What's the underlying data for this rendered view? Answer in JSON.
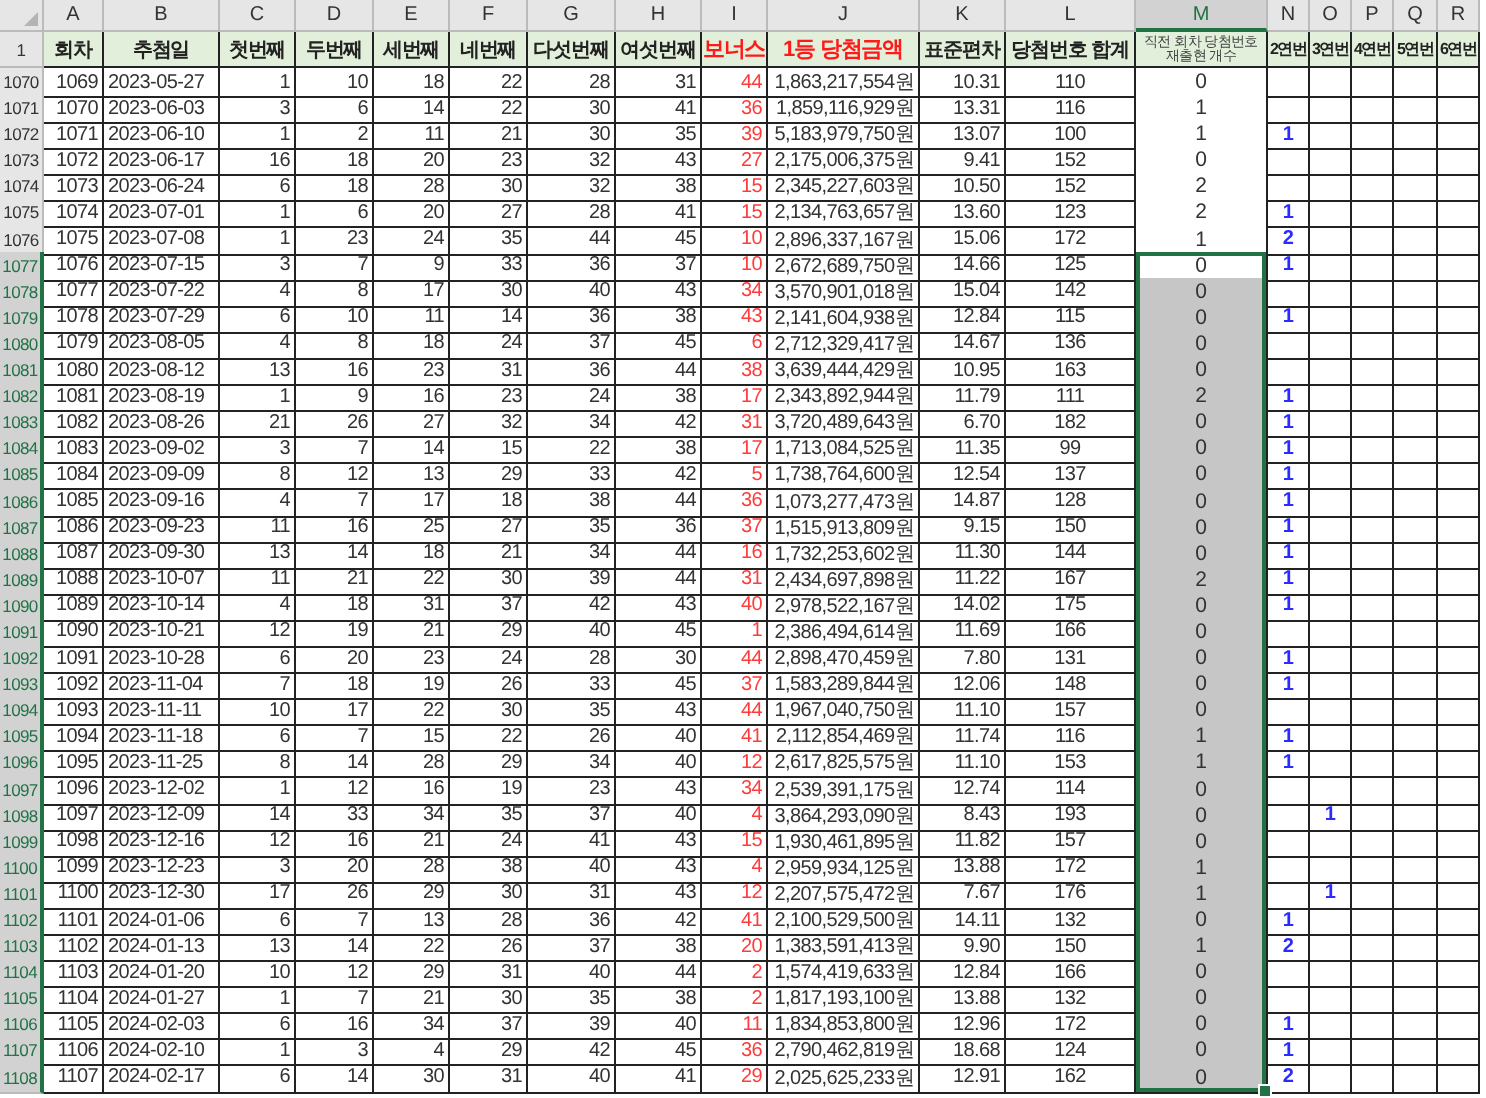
{
  "columns": [
    {
      "letter": "A",
      "selected": false
    },
    {
      "letter": "B",
      "selected": false
    },
    {
      "letter": "C",
      "selected": false
    },
    {
      "letter": "D",
      "selected": false
    },
    {
      "letter": "E",
      "selected": false
    },
    {
      "letter": "F",
      "selected": false
    },
    {
      "letter": "G",
      "selected": false
    },
    {
      "letter": "H",
      "selected": false
    },
    {
      "letter": "I",
      "selected": false
    },
    {
      "letter": "J",
      "selected": false
    },
    {
      "letter": "K",
      "selected": false
    },
    {
      "letter": "L",
      "selected": false
    },
    {
      "letter": "M",
      "selected": true
    },
    {
      "letter": "N",
      "selected": false
    },
    {
      "letter": "O",
      "selected": false
    },
    {
      "letter": "P",
      "selected": false
    },
    {
      "letter": "Q",
      "selected": false
    },
    {
      "letter": "R",
      "selected": false
    }
  ],
  "header_row": "1",
  "headers": [
    {
      "text": "회차",
      "kind": "plain"
    },
    {
      "text": "추첨일",
      "kind": "plain"
    },
    {
      "text": "첫번째",
      "kind": "plain"
    },
    {
      "text": "두번째",
      "kind": "plain"
    },
    {
      "text": "세번째",
      "kind": "plain"
    },
    {
      "text": "네번째",
      "kind": "plain"
    },
    {
      "text": "다섯번째",
      "kind": "plain"
    },
    {
      "text": "여섯번째",
      "kind": "plain"
    },
    {
      "text": "보너스",
      "kind": "red"
    },
    {
      "text": "1등 당첨금액",
      "kind": "red"
    },
    {
      "text": "표준편차",
      "kind": "plain"
    },
    {
      "text": "당첨번호 합계",
      "kind": "plain"
    },
    {
      "text": "직전 회차 당첨번호 재출현 개수",
      "kind": "tiny"
    },
    {
      "text": "2연번",
      "kind": "small"
    },
    {
      "text": "3연번",
      "kind": "small"
    },
    {
      "text": "4연번",
      "kind": "small"
    },
    {
      "text": "5연번",
      "kind": "small"
    },
    {
      "text": "6연번",
      "kind": "small"
    }
  ],
  "rows": [
    {
      "row": "1070",
      "round": "1069",
      "date": "2023-05-27",
      "numbers": [
        "1",
        "10",
        "18",
        "22",
        "28",
        "31"
      ],
      "bonus": "44",
      "prize": "1,863,217,554원",
      "stdev": "10.31",
      "sum": "110",
      "repeat": "0",
      "selected": false,
      "active": false
    },
    {
      "row": "1071",
      "round": "1070",
      "date": "2023-06-03",
      "numbers": [
        "3",
        "6",
        "14",
        "22",
        "30",
        "41"
      ],
      "bonus": "36",
      "prize": "1,859,116,929원",
      "stdev": "13.31",
      "sum": "116",
      "repeat": "1",
      "selected": false,
      "active": false
    },
    {
      "row": "1072",
      "round": "1071",
      "date": "2023-06-10",
      "numbers": [
        "1",
        "2",
        "11",
        "21",
        "30",
        "35"
      ],
      "bonus": "39",
      "prize": "5,183,979,750원",
      "stdev": "13.07",
      "sum": "100",
      "repeat": "1",
      "run2": "1",
      "selected": false,
      "active": false
    },
    {
      "row": "1073",
      "round": "1072",
      "date": "2023-06-17",
      "numbers": [
        "16",
        "18",
        "20",
        "23",
        "32",
        "43"
      ],
      "bonus": "27",
      "prize": "2,175,006,375원",
      "stdev": "9.41",
      "sum": "152",
      "repeat": "0",
      "selected": false,
      "active": false
    },
    {
      "row": "1074",
      "round": "1073",
      "date": "2023-06-24",
      "numbers": [
        "6",
        "18",
        "28",
        "30",
        "32",
        "38"
      ],
      "bonus": "15",
      "prize": "2,345,227,603원",
      "stdev": "10.50",
      "sum": "152",
      "repeat": "2",
      "selected": false,
      "active": false
    },
    {
      "row": "1075",
      "round": "1074",
      "date": "2023-07-01",
      "numbers": [
        "1",
        "6",
        "20",
        "27",
        "28",
        "41"
      ],
      "bonus": "15",
      "prize": "2,134,763,657원",
      "stdev": "13.60",
      "sum": "123",
      "repeat": "2",
      "run2": "1",
      "selected": false,
      "active": false
    },
    {
      "row": "1076",
      "round": "1075",
      "date": "2023-07-08",
      "numbers": [
        "1",
        "23",
        "24",
        "35",
        "44",
        "45"
      ],
      "bonus": "10",
      "prize": "2,896,337,167원",
      "stdev": "15.06",
      "sum": "172",
      "repeat": "1",
      "run2": "2",
      "selected": false,
      "active": false
    },
    {
      "row": "1077",
      "round": "1076",
      "date": "2023-07-15",
      "numbers": [
        "3",
        "7",
        "9",
        "33",
        "36",
        "37"
      ],
      "bonus": "10",
      "prize": "2,672,689,750원",
      "stdev": "14.66",
      "sum": "125",
      "repeat": "0",
      "run2": "1",
      "selected": true,
      "active": true
    },
    {
      "row": "1078",
      "round": "1077",
      "date": "2023-07-22",
      "numbers": [
        "4",
        "8",
        "17",
        "30",
        "40",
        "43"
      ],
      "bonus": "34",
      "prize": "3,570,901,018원",
      "stdev": "15.04",
      "sum": "142",
      "repeat": "0",
      "selected": true,
      "active": false
    },
    {
      "row": "1079",
      "round": "1078",
      "date": "2023-07-29",
      "numbers": [
        "6",
        "10",
        "11",
        "14",
        "36",
        "38"
      ],
      "bonus": "43",
      "prize": "2,141,604,938원",
      "stdev": "12.84",
      "sum": "115",
      "repeat": "0",
      "run2": "1",
      "selected": true,
      "active": false
    },
    {
      "row": "1080",
      "round": "1079",
      "date": "2023-08-05",
      "numbers": [
        "4",
        "8",
        "18",
        "24",
        "37",
        "45"
      ],
      "bonus": "6",
      "prize": "2,712,329,417원",
      "stdev": "14.67",
      "sum": "136",
      "repeat": "0",
      "selected": true,
      "active": false
    },
    {
      "row": "1081",
      "round": "1080",
      "date": "2023-08-12",
      "numbers": [
        "13",
        "16",
        "23",
        "31",
        "36",
        "44"
      ],
      "bonus": "38",
      "prize": "3,639,444,429원",
      "stdev": "10.95",
      "sum": "163",
      "repeat": "0",
      "selected": true,
      "active": false
    },
    {
      "row": "1082",
      "round": "1081",
      "date": "2023-08-19",
      "numbers": [
        "1",
        "9",
        "16",
        "23",
        "24",
        "38"
      ],
      "bonus": "17",
      "prize": "2,343,892,944원",
      "stdev": "11.79",
      "sum": "111",
      "repeat": "2",
      "run2": "1",
      "selected": true,
      "active": false
    },
    {
      "row": "1083",
      "round": "1082",
      "date": "2023-08-26",
      "numbers": [
        "21",
        "26",
        "27",
        "32",
        "34",
        "42"
      ],
      "bonus": "31",
      "prize": "3,720,489,643원",
      "stdev": "6.70",
      "sum": "182",
      "repeat": "0",
      "run2": "1",
      "selected": true,
      "active": false
    },
    {
      "row": "1084",
      "round": "1083",
      "date": "2023-09-02",
      "numbers": [
        "3",
        "7",
        "14",
        "15",
        "22",
        "38"
      ],
      "bonus": "17",
      "prize": "1,713,084,525원",
      "stdev": "11.35",
      "sum": "99",
      "repeat": "0",
      "run2": "1",
      "selected": true,
      "active": false
    },
    {
      "row": "1085",
      "round": "1084",
      "date": "2023-09-09",
      "numbers": [
        "8",
        "12",
        "13",
        "29",
        "33",
        "42"
      ],
      "bonus": "5",
      "prize": "1,738,764,600원",
      "stdev": "12.54",
      "sum": "137",
      "repeat": "0",
      "run2": "1",
      "selected": true,
      "active": false
    },
    {
      "row": "1086",
      "round": "1085",
      "date": "2023-09-16",
      "numbers": [
        "4",
        "7",
        "17",
        "18",
        "38",
        "44"
      ],
      "bonus": "36",
      "prize": "1,073,277,473원",
      "stdev": "14.87",
      "sum": "128",
      "repeat": "0",
      "run2": "1",
      "selected": true,
      "active": false
    },
    {
      "row": "1087",
      "round": "1086",
      "date": "2023-09-23",
      "numbers": [
        "11",
        "16",
        "25",
        "27",
        "35",
        "36"
      ],
      "bonus": "37",
      "prize": "1,515,913,809원",
      "stdev": "9.15",
      "sum": "150",
      "repeat": "0",
      "run2": "1",
      "selected": true,
      "active": false
    },
    {
      "row": "1088",
      "round": "1087",
      "date": "2023-09-30",
      "numbers": [
        "13",
        "14",
        "18",
        "21",
        "34",
        "44"
      ],
      "bonus": "16",
      "prize": "1,732,253,602원",
      "stdev": "11.30",
      "sum": "144",
      "repeat": "0",
      "run2": "1",
      "selected": true,
      "active": false
    },
    {
      "row": "1089",
      "round": "1088",
      "date": "2023-10-07",
      "numbers": [
        "11",
        "21",
        "22",
        "30",
        "39",
        "44"
      ],
      "bonus": "31",
      "prize": "2,434,697,898원",
      "stdev": "11.22",
      "sum": "167",
      "repeat": "2",
      "run2": "1",
      "selected": true,
      "active": false
    },
    {
      "row": "1090",
      "round": "1089",
      "date": "2023-10-14",
      "numbers": [
        "4",
        "18",
        "31",
        "37",
        "42",
        "43"
      ],
      "bonus": "40",
      "prize": "2,978,522,167원",
      "stdev": "14.02",
      "sum": "175",
      "repeat": "0",
      "run2": "1",
      "selected": true,
      "active": false
    },
    {
      "row": "1091",
      "round": "1090",
      "date": "2023-10-21",
      "numbers": [
        "12",
        "19",
        "21",
        "29",
        "40",
        "45"
      ],
      "bonus": "1",
      "prize": "2,386,494,614원",
      "stdev": "11.69",
      "sum": "166",
      "repeat": "0",
      "selected": true,
      "active": false
    },
    {
      "row": "1092",
      "round": "1091",
      "date": "2023-10-28",
      "numbers": [
        "6",
        "20",
        "23",
        "24",
        "28",
        "30"
      ],
      "bonus": "44",
      "prize": "2,898,470,459원",
      "stdev": "7.80",
      "sum": "131",
      "repeat": "0",
      "run2": "1",
      "selected": true,
      "active": false
    },
    {
      "row": "1093",
      "round": "1092",
      "date": "2023-11-04",
      "numbers": [
        "7",
        "18",
        "19",
        "26",
        "33",
        "45"
      ],
      "bonus": "37",
      "prize": "1,583,289,844원",
      "stdev": "12.06",
      "sum": "148",
      "repeat": "0",
      "run2": "1",
      "selected": true,
      "active": false
    },
    {
      "row": "1094",
      "round": "1093",
      "date": "2023-11-11",
      "numbers": [
        "10",
        "17",
        "22",
        "30",
        "35",
        "43"
      ],
      "bonus": "44",
      "prize": "1,967,040,750원",
      "stdev": "11.10",
      "sum": "157",
      "repeat": "0",
      "selected": true,
      "active": false
    },
    {
      "row": "1095",
      "round": "1094",
      "date": "2023-11-18",
      "numbers": [
        "6",
        "7",
        "15",
        "22",
        "26",
        "40"
      ],
      "bonus": "41",
      "prize": "2,112,854,469원",
      "stdev": "11.74",
      "sum": "116",
      "repeat": "1",
      "run2": "1",
      "selected": true,
      "active": false
    },
    {
      "row": "1096",
      "round": "1095",
      "date": "2023-11-25",
      "numbers": [
        "8",
        "14",
        "28",
        "29",
        "34",
        "40"
      ],
      "bonus": "12",
      "prize": "2,617,825,575원",
      "stdev": "11.10",
      "sum": "153",
      "repeat": "1",
      "run2": "1",
      "selected": true,
      "active": false
    },
    {
      "row": "1097",
      "round": "1096",
      "date": "2023-12-02",
      "numbers": [
        "1",
        "12",
        "16",
        "19",
        "23",
        "43"
      ],
      "bonus": "34",
      "prize": "2,539,391,175원",
      "stdev": "12.74",
      "sum": "114",
      "repeat": "0",
      "selected": true,
      "active": false
    },
    {
      "row": "1098",
      "round": "1097",
      "date": "2023-12-09",
      "numbers": [
        "14",
        "33",
        "34",
        "35",
        "37",
        "40"
      ],
      "bonus": "4",
      "prize": "3,864,293,090원",
      "stdev": "8.43",
      "sum": "193",
      "repeat": "0",
      "run3": "1",
      "selected": true,
      "active": false
    },
    {
      "row": "1099",
      "round": "1098",
      "date": "2023-12-16",
      "numbers": [
        "12",
        "16",
        "21",
        "24",
        "41",
        "43"
      ],
      "bonus": "15",
      "prize": "1,930,461,895원",
      "stdev": "11.82",
      "sum": "157",
      "repeat": "0",
      "selected": true,
      "active": false
    },
    {
      "row": "1100",
      "round": "1099",
      "date": "2023-12-23",
      "numbers": [
        "3",
        "20",
        "28",
        "38",
        "40",
        "43"
      ],
      "bonus": "4",
      "prize": "2,959,934,125원",
      "stdev": "13.88",
      "sum": "172",
      "repeat": "1",
      "selected": true,
      "active": false
    },
    {
      "row": "1101",
      "round": "1100",
      "date": "2023-12-30",
      "numbers": [
        "17",
        "26",
        "29",
        "30",
        "31",
        "43"
      ],
      "bonus": "12",
      "prize": "2,207,575,472원",
      "stdev": "7.67",
      "sum": "176",
      "repeat": "1",
      "run3": "1",
      "selected": true,
      "active": false
    },
    {
      "row": "1102",
      "round": "1101",
      "date": "2024-01-06",
      "numbers": [
        "6",
        "7",
        "13",
        "28",
        "36",
        "42"
      ],
      "bonus": "41",
      "prize": "2,100,529,500원",
      "stdev": "14.11",
      "sum": "132",
      "repeat": "0",
      "run2": "1",
      "selected": true,
      "active": false
    },
    {
      "row": "1103",
      "round": "1102",
      "date": "2024-01-13",
      "numbers": [
        "13",
        "14",
        "22",
        "26",
        "37",
        "38"
      ],
      "bonus": "20",
      "prize": "1,383,591,413원",
      "stdev": "9.90",
      "sum": "150",
      "repeat": "1",
      "run2": "2",
      "selected": true,
      "active": false
    },
    {
      "row": "1104",
      "round": "1103",
      "date": "2024-01-20",
      "numbers": [
        "10",
        "12",
        "29",
        "31",
        "40",
        "44"
      ],
      "bonus": "2",
      "prize": "1,574,419,633원",
      "stdev": "12.84",
      "sum": "166",
      "repeat": "0",
      "selected": true,
      "active": false
    },
    {
      "row": "1105",
      "round": "1104",
      "date": "2024-01-27",
      "numbers": [
        "1",
        "7",
        "21",
        "30",
        "35",
        "38"
      ],
      "bonus": "2",
      "prize": "1,817,193,100원",
      "stdev": "13.88",
      "sum": "132",
      "repeat": "0",
      "selected": true,
      "active": false
    },
    {
      "row": "1106",
      "round": "1105",
      "date": "2024-02-03",
      "numbers": [
        "6",
        "16",
        "34",
        "37",
        "39",
        "40"
      ],
      "bonus": "11",
      "prize": "1,834,853,800원",
      "stdev": "12.96",
      "sum": "172",
      "repeat": "0",
      "run2": "1",
      "selected": true,
      "active": false
    },
    {
      "row": "1107",
      "round": "1106",
      "date": "2024-02-10",
      "numbers": [
        "1",
        "3",
        "4",
        "29",
        "42",
        "45"
      ],
      "bonus": "36",
      "prize": "2,790,462,819원",
      "stdev": "18.68",
      "sum": "124",
      "repeat": "0",
      "run2": "1",
      "selected": true,
      "active": false
    },
    {
      "row": "1108",
      "round": "1107",
      "date": "2024-02-17",
      "numbers": [
        "6",
        "14",
        "30",
        "31",
        "40",
        "41"
      ],
      "bonus": "29",
      "prize": "2,025,625,233원",
      "stdev": "12.91",
      "sum": "162",
      "repeat": "0",
      "run2": "2",
      "selected": true,
      "active": false
    }
  ]
}
